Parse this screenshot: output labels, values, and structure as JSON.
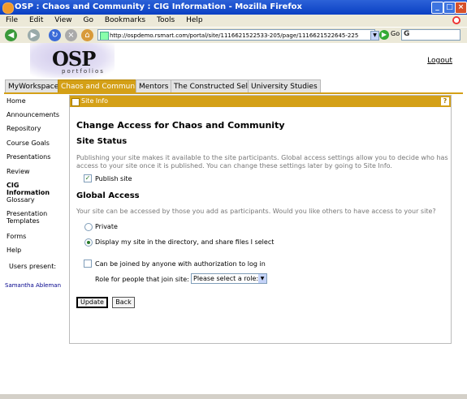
{
  "window": {
    "title": "OSP : Chaos and Community : CIG Information - Mozilla Firefox",
    "minimize": "_",
    "maximize": "□",
    "close": "×"
  },
  "menu": [
    "File",
    "Edit",
    "View",
    "Go",
    "Bookmarks",
    "Tools",
    "Help"
  ],
  "toolbar": {
    "url": "http://ospdemo.rsmart.com/portal/site/1116621522533-205/page/1116621522645-225",
    "go_label": "Go",
    "search_glyph": "G"
  },
  "header": {
    "logo_text": "OSP",
    "logo_subtext": "portfolios",
    "logout": "Logout"
  },
  "tabs": [
    {
      "label": "MyWorkspace",
      "active": false
    },
    {
      "label": "Chaos and Community",
      "active": true
    },
    {
      "label": "Mentors",
      "active": false
    },
    {
      "label": "The Constructed Self",
      "active": false
    },
    {
      "label": "University Studies",
      "active": false
    }
  ],
  "leftnav": {
    "items": [
      "Home",
      "Announcements",
      "Repository",
      "Course Goals",
      "Presentations",
      "Review",
      "CIG Information",
      "Glossary",
      "Presentation Templates",
      "Forms",
      "Help"
    ],
    "users_present_label": "Users present:",
    "user": "Samantha Ableman"
  },
  "tool": {
    "title": "Site Info",
    "help": "?",
    "heading": "Change Access for Chaos and Community",
    "site_status": {
      "heading": "Site Status",
      "description": "Publishing your site makes it available to the site participants. Global access settings allow you to decide who has access to your site once it is published. You can change these settings later by going to Site Info.",
      "publish_label": "Publish site",
      "publish_checked": true
    },
    "global_access": {
      "heading": "Global Access",
      "description": "Your site can be accessed by those you add as participants. Would you like others to have access to your site?",
      "options": [
        {
          "label": "Private",
          "selected": false
        },
        {
          "label": "Display my site in the directory, and share files I select",
          "selected": true
        }
      ],
      "joinable_label": "Can be joined by anyone with authorization to log in",
      "joinable_checked": false,
      "role_label": "Role for people that join site:",
      "role_select": "Please select a role:"
    },
    "buttons": {
      "update": "Update",
      "back": "Back"
    }
  }
}
